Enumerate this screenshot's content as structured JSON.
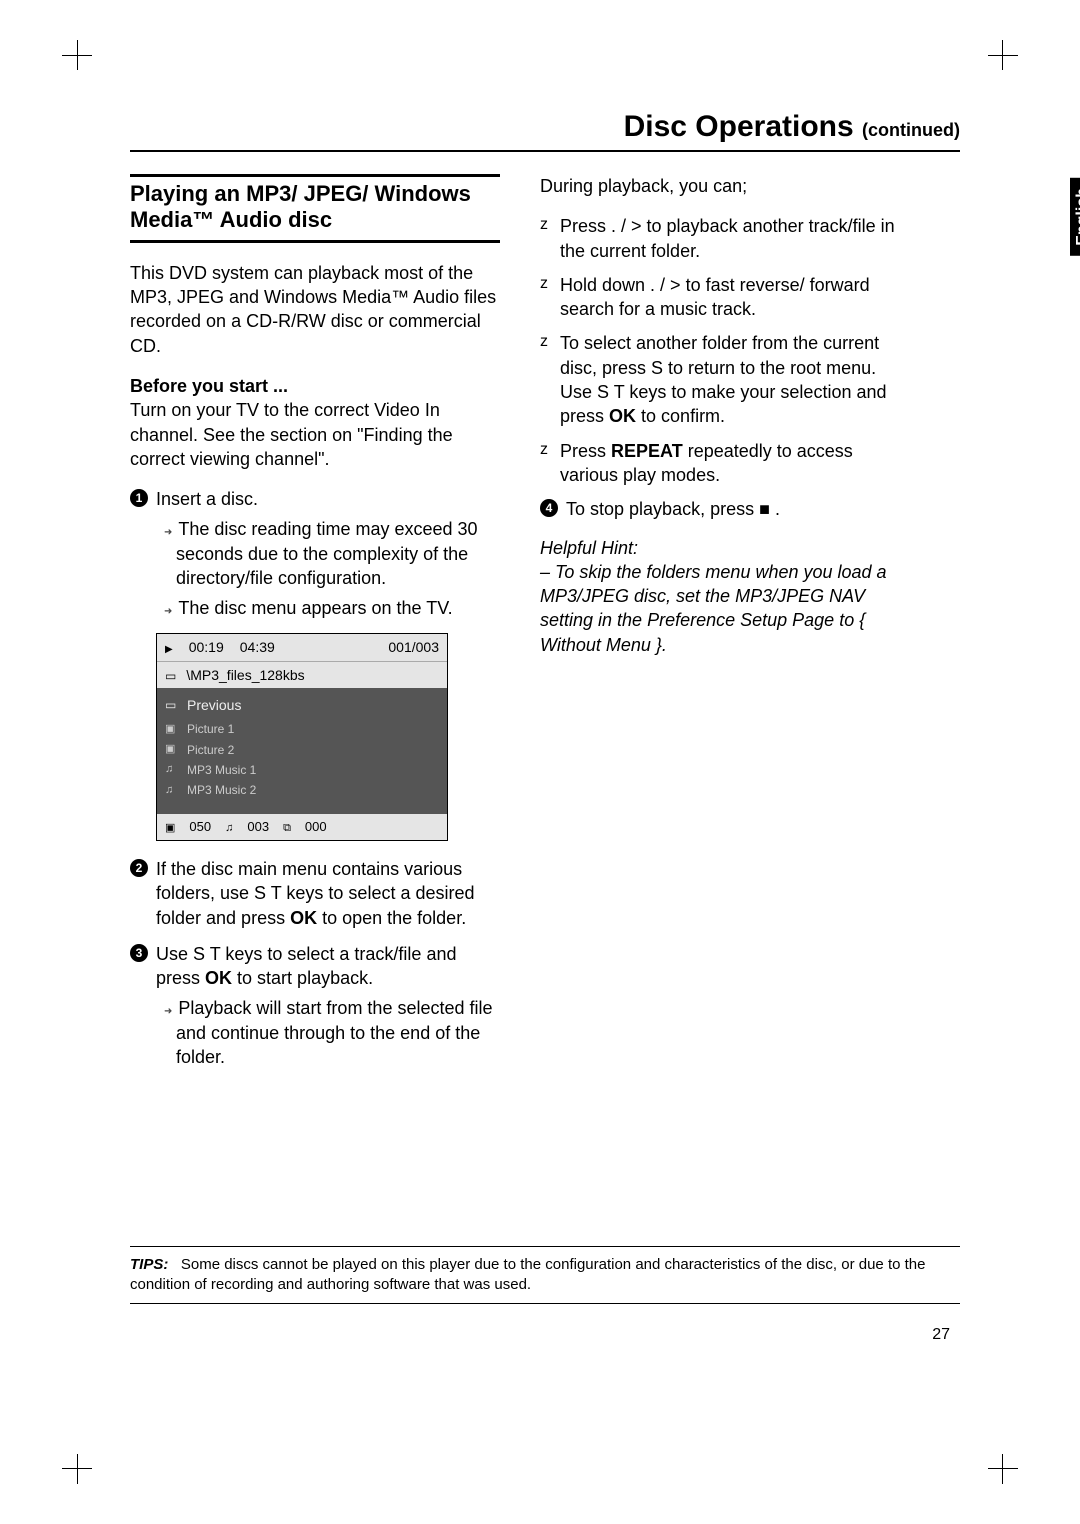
{
  "header": {
    "title": "Disc Operations",
    "continued": "(continued)"
  },
  "language_tab": "English",
  "left": {
    "section_title": "Playing an MP3/ JPEG/ Windows Media™ Audio disc",
    "intro": "This DVD system can playback most of the MP3, JPEG and Windows Media™ Audio files recorded on a CD-R/RW disc or commercial CD.",
    "before_label": "Before you start ...",
    "before_text": "Turn on your TV to the correct Video In channel.  See the section on \"Finding the correct viewing channel\".",
    "step1": {
      "text": "Insert a disc.",
      "sub1": "The disc reading time may exceed 30 seconds due to the complexity of the directory/file configuration.",
      "sub2": "The disc menu appears on the TV."
    },
    "disc_menu": {
      "time_elapsed": "00:19",
      "time_total": "04:39",
      "track_index": "001/003",
      "path": "\\MP3_files_128kbs",
      "items": [
        {
          "icon": "folder",
          "label": "Previous"
        },
        {
          "icon": "pic",
          "label": "Picture 1"
        },
        {
          "icon": "pic",
          "label": "Picture 2"
        },
        {
          "icon": "music",
          "label": "MP3 Music 1"
        },
        {
          "icon": "music",
          "label": "MP3 Music 2"
        }
      ],
      "footer": {
        "pics": "050",
        "music": "003",
        "video": "000"
      }
    },
    "step2_a": "If the disc main menu contains various folders, use  S T  keys to select a desired folder and press ",
    "step2_ok": "OK",
    "step2_b": " to open the folder.",
    "step3_a": "Use  S T  keys to select a track/file and press ",
    "step3_ok": "OK",
    "step3_b": " to start playback.",
    "step3_sub": "Playback will start from the selected file and continue through to the end of the folder."
  },
  "right": {
    "during": "During playback, you can;",
    "b1": "Press  .       /  >       to playback another track/file in the current folder.",
    "b2": "Hold down  .       /  >       to fast reverse/ forward search for a music track.",
    "b3_a": "To select another folder from the current disc, press  S  to return to the root menu.  Use  S T  keys to make your selection and press ",
    "b3_ok": "OK",
    "b3_b": " to confirm.",
    "b4_a": "Press ",
    "b4_repeat": "REPEAT",
    "b4_b": " repeatedly to access various play modes.",
    "step4": "To stop playback, press  ■   .",
    "hint_label": "Helpful Hint:",
    "hint_text": "–  To skip the folders menu when you load a MP3/JPEG disc, set the MP3/JPEG NAV setting in the Preference Setup Page to { Without Menu }."
  },
  "tips": {
    "label": "TIPS:",
    "text": "Some discs cannot be played on this player due to the configuration and characteristics of the disc, or due to the condition of recording and authoring software that was used."
  },
  "page_number": "27"
}
